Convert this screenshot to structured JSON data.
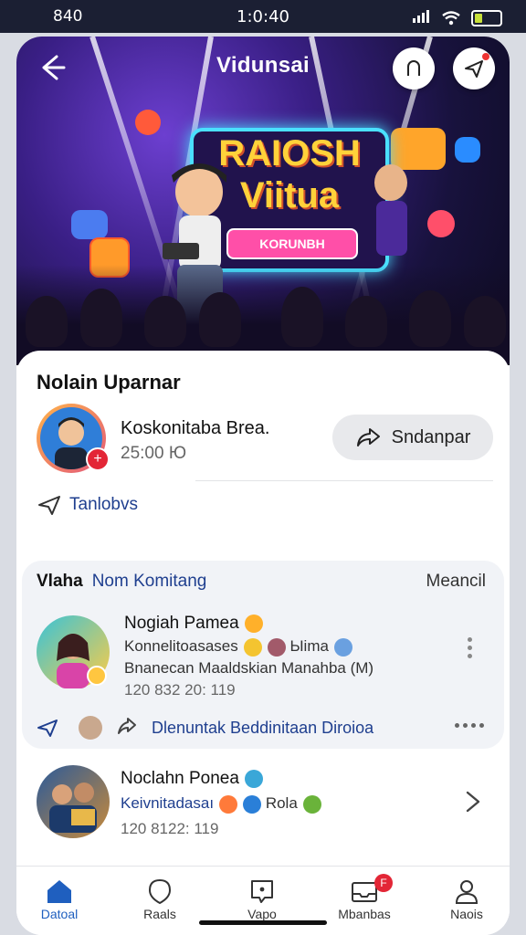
{
  "status": {
    "carrier": "840",
    "time": "1:0:40"
  },
  "header": {
    "title": "Vidunsai"
  },
  "hero": {
    "sign_line1": "RAIOSH",
    "sign_line2": "Viitua",
    "sign_tag": "KORUNBH"
  },
  "host": {
    "section_title": "Nolain Uparnar",
    "name": "Koskonitaba Brea.",
    "meta": "25:00 Ю",
    "share_label": "Sndanpar",
    "follow_label": "Tanlobvs"
  },
  "comments": {
    "title": "Vlaha",
    "subtitle": "Nom Komitang",
    "more_label": "Meancil",
    "items": [
      {
        "name": "Nogiah Pamea",
        "line1_a": "Konnelitoasases",
        "line1_b": "Ыima",
        "line2": "Bnanecan Maaldskian Manahba (M)",
        "time": "120 832 20: 119",
        "action_label": "Dlenuntak Beddinitaan Diroioa"
      },
      {
        "name": "Noclahn Ponea",
        "line1_a": "Keivnitadasaı",
        "line1_b": "Rola",
        "time": "120 8122: 119"
      }
    ]
  },
  "tabs": [
    {
      "label": "Datoal",
      "active": true
    },
    {
      "label": "Raals"
    },
    {
      "label": "Vapo"
    },
    {
      "label": "Mbanbas",
      "badge": "F"
    },
    {
      "label": "Naois"
    }
  ]
}
